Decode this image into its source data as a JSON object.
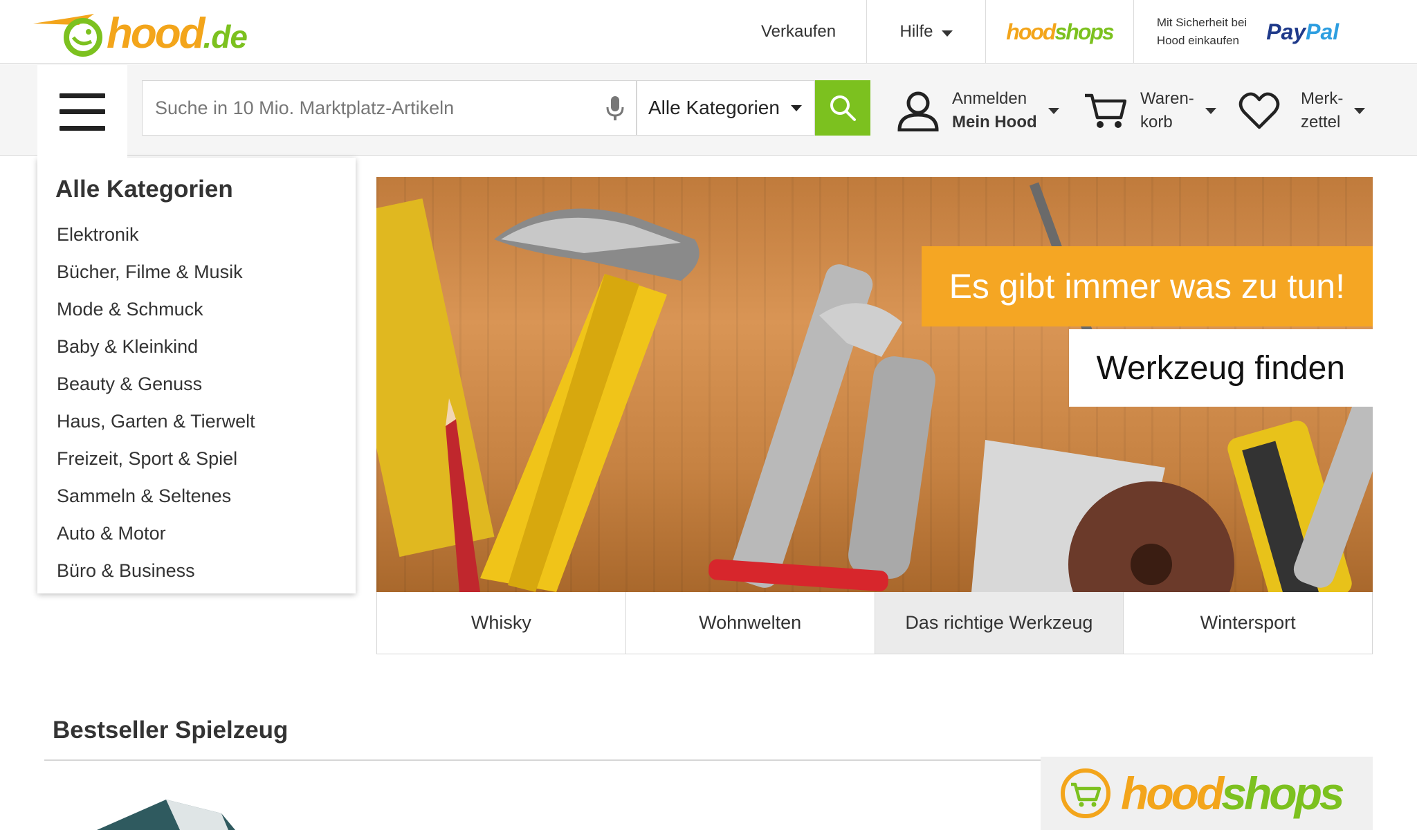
{
  "header": {
    "logo": {
      "word": "hood",
      "tld": ".de"
    },
    "links": {
      "sell": "Verkaufen",
      "help": "Hilfe"
    },
    "hoodshops": {
      "part1": "hood",
      "part2": "shops"
    },
    "paypal": {
      "line1": "Mit Sicherheit bei",
      "line2": "Hood einkaufen",
      "brand1": "Pay",
      "brand2": "Pal"
    }
  },
  "nav": {
    "search": {
      "placeholder": "Suche in 10 Mio. Marktplatz-Artikeln"
    },
    "category_select": "Alle Kategorien",
    "account": {
      "line1": "Anmelden",
      "line2": "Mein Hood"
    },
    "cart": {
      "line1": "Waren-",
      "line2": "korb"
    },
    "wishlist": {
      "line1": "Merk-",
      "line2": "zettel"
    }
  },
  "categories": {
    "title": "Alle Kategorien",
    "items": [
      "Elektronik",
      "Bücher, Filme & Musik",
      "Mode & Schmuck",
      "Baby & Kleinkind",
      "Beauty & Genuss",
      "Haus, Garten & Tierwelt",
      "Freizeit, Sport & Spiel",
      "Sammeln & Seltenes",
      "Auto & Motor",
      "Büro & Business"
    ]
  },
  "hero": {
    "headline": "Es gibt immer was zu tun!",
    "cta": "Werkzeug finden"
  },
  "tabs": [
    {
      "label": "Whisky",
      "active": false
    },
    {
      "label": "Wohnwelten",
      "active": false
    },
    {
      "label": "Das richtige Werkzeug",
      "active": true
    },
    {
      "label": "Wintersport",
      "active": false
    }
  ],
  "bestseller": {
    "title": "Bestseller Spielzeug"
  },
  "promo": {
    "part1": "hood",
    "part2": "shops"
  },
  "colors": {
    "brand_green": "#7cc11f",
    "brand_orange": "#f3a51b",
    "banner_orange": "#f5a623"
  }
}
